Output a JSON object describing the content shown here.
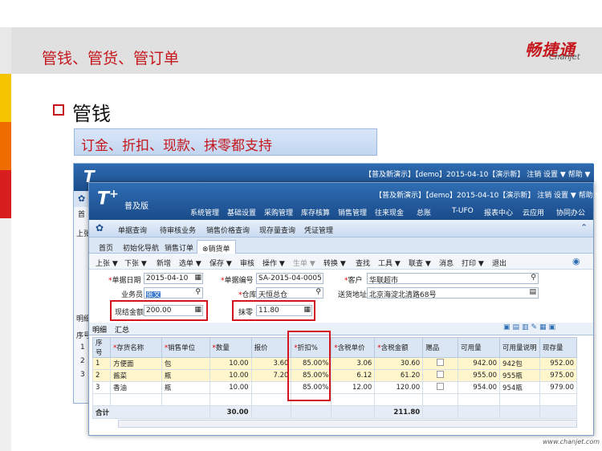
{
  "slide": {
    "title": "管钱、管货、管订单",
    "logo_cn": "畅捷通",
    "logo_en": "Chanjet",
    "section": "管钱",
    "callout": "订金、折扣、现款、抹零都支持",
    "footer_url": "www.chanjet.com"
  },
  "back_window": {
    "info": "【普及新演示】【demo】2015-04-10【演示新】 注销  设置 ▼  帮助 ▼",
    "side": [
      "首",
      "上张",
      "明细",
      "序号",
      "1",
      "2",
      "3"
    ]
  },
  "app": {
    "logo": "T",
    "edition": "普及版",
    "top_info": "【普及新演示】【demo】2015-04-10【演示新】  注销  设置 ▼  帮助 ▼",
    "nav": [
      "系统管理",
      "基础设置",
      "采购管理",
      "库存核算",
      "销售管理",
      "往来现金",
      "总账",
      "T-UFO",
      "报表中心",
      "云应用",
      "协同办公"
    ],
    "quick": [
      "单据查询",
      "待审核业务",
      "销售价格查询",
      "现存量查询",
      "凭证管理"
    ],
    "tabs": [
      "首页",
      "初始化导航",
      "销售订单",
      "销货单"
    ],
    "toolbar": [
      "上张 ▼",
      "下张 ▼",
      "新增",
      "选单 ▼",
      "保存 ▼",
      "审核",
      "操作 ▼",
      "生单 ▼",
      "转换 ▼",
      "查找",
      "工具 ▼",
      "联查 ▼",
      "消息",
      "打印 ▼",
      "退出"
    ],
    "form": {
      "date_label": "单据日期",
      "date_value": "2015-04-10",
      "no_label": "单据编号",
      "no_value": "SA-2015-04-0005",
      "customer_label": "客户",
      "customer_value": "华联超市",
      "clerk_label": "业务员",
      "clerk_value": "张文",
      "warehouse_label": "仓库",
      "warehouse_value": "天恒总仓",
      "address_label": "送货地址",
      "address_value": "北京海淀北清路68号",
      "cash_label": "现结金额",
      "cash_value": "200.00",
      "round_label": "抹零",
      "round_value": "11.80"
    },
    "grid_tabs": [
      "明细",
      "汇总"
    ],
    "columns": [
      "序号",
      "存货名称",
      "销售单位",
      "数量",
      "报价",
      "折扣%",
      "含税单价",
      "含税金额",
      "赠品",
      "可用量",
      "可用量说明",
      "现存量"
    ],
    "rows": [
      [
        "1",
        "方便面",
        "包",
        "10.00",
        "3.60",
        "85.00%",
        "3.06",
        "30.60",
        "",
        "942.00",
        "942包",
        "952.00"
      ],
      [
        "2",
        "酱菜",
        "瓶",
        "10.00",
        "7.20",
        "85.00%",
        "6.12",
        "61.20",
        "",
        "955.00",
        "955瓶",
        "975.00"
      ],
      [
        "3",
        "香油",
        "瓶",
        "10.00",
        "",
        "85.00%",
        "12.00",
        "120.00",
        "",
        "954.00",
        "954瓶",
        "979.00"
      ]
    ],
    "total": {
      "label": "合计",
      "qty": "30.00",
      "amount": "211.80"
    }
  },
  "colors": {
    "accent": "#c4161c",
    "app_blue": "#1b4e8c",
    "highlight_row": "#fff6cc"
  }
}
